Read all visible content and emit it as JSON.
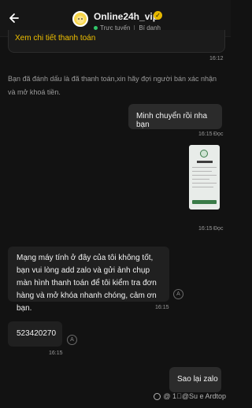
{
  "header": {
    "title": "Online24h_vip",
    "status_online": "Trực tuyến",
    "status_personal": "Bí danh",
    "verified_glyph": "✓"
  },
  "card": {
    "link": "Xem chi tiết thanh toán",
    "time": "16:12"
  },
  "system_message": "Bạn đã đánh dấu là đã thanh toán,xin hãy đợi người bán xác nhận và mở khoá tiền.",
  "messages": [
    {
      "text": "Minh chuyển rồi nha bạn",
      "time": "16:15",
      "read": "Đọc"
    },
    {
      "image": "payment-receipt-screenshot",
      "time": "16:15",
      "read": "Đọc"
    },
    {
      "text": "Mạng máy tính ở đây của tôi không tốt, bạn vui lòng add zalo và gửi ảnh chụp màn hình thanh toán để tôi kiểm tra đơn hàng và mở khóa nhanh chóng, cảm ơn bạn.",
      "time": "16:15"
    },
    {
      "text": "523420270",
      "time": "16:15"
    },
    {
      "text": "Sao lại zalo"
    }
  ],
  "watermark": "@ 1⃞@Su e Ardtop",
  "colors": {
    "background": "#121212",
    "accent": "#f0c000",
    "online": "#31c76a",
    "outgoing_bubble": "#2b2b2b",
    "incoming_bubble": "#202020"
  }
}
